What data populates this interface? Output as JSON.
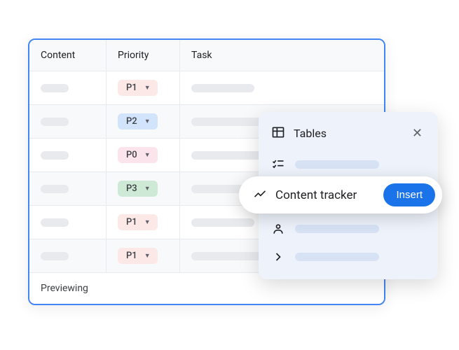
{
  "table": {
    "columns": {
      "content": "Content",
      "priority": "Priority",
      "task": "Task"
    },
    "rows": [
      {
        "priority": "P1",
        "chipClass": "chip-p1"
      },
      {
        "priority": "P2",
        "chipClass": "chip-p2"
      },
      {
        "priority": "P0",
        "chipClass": "chip-p0"
      },
      {
        "priority": "P3",
        "chipClass": "chip-p3"
      },
      {
        "priority": "P1",
        "chipClass": "chip-p1"
      },
      {
        "priority": "P1",
        "chipClass": "chip-p1"
      }
    ],
    "previewing": "Previewing"
  },
  "panel": {
    "title": "Tables",
    "selected_label": "Content tracker",
    "insert": "Insert"
  }
}
